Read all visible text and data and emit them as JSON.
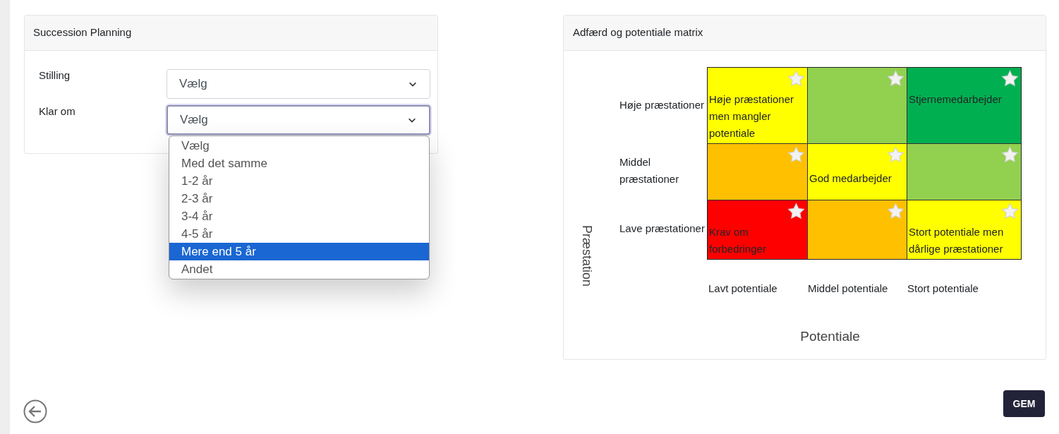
{
  "succession": {
    "title": "Succession Planning",
    "fields": [
      {
        "label": "Stilling",
        "value": "Vælg",
        "focused": false
      },
      {
        "label": "Klar om",
        "value": "Vælg",
        "focused": true
      }
    ],
    "dropdown": {
      "options": [
        {
          "label": "Vælg",
          "selected": false
        },
        {
          "label": "Med det samme",
          "selected": false
        },
        {
          "label": "1-2 år",
          "selected": false
        },
        {
          "label": "2-3 år",
          "selected": false
        },
        {
          "label": "3-4 år",
          "selected": false
        },
        {
          "label": "4-5 år",
          "selected": false
        },
        {
          "label": "Mere end 5 år",
          "selected": true
        },
        {
          "label": "Andet",
          "selected": false
        }
      ]
    }
  },
  "matrix": {
    "title": "Adfærd og potentiale matrix",
    "y_axis_label": "Præstation",
    "row_labels": [
      "Høje præstationer",
      "Middel præstationer",
      "Lave præstationer"
    ],
    "rows": [
      [
        {
          "label": "Høje præstationer men mangler potentiale",
          "color": "#ffff00"
        },
        {
          "color": "#92d050"
        },
        {
          "label": "Stjernemedarbejder",
          "color": "#00b050"
        }
      ],
      [
        {
          "color": "#ffc000"
        },
        {
          "label": "God medarbejder",
          "color": "#ffff00"
        },
        {
          "color": "#92d050"
        }
      ],
      [
        {
          "label": "Krav om forbedringer",
          "color": "#ff0000"
        },
        {
          "color": "#ffc000"
        },
        {
          "label": "Stort potentiale men dårlige præstationer",
          "color": "#ffff00"
        }
      ]
    ],
    "column_labels": [
      "Lavt potentiale",
      "Middel potentiale",
      "Stort potentiale"
    ],
    "x_axis_label": "Potentiale"
  },
  "save_button": "GEM"
}
